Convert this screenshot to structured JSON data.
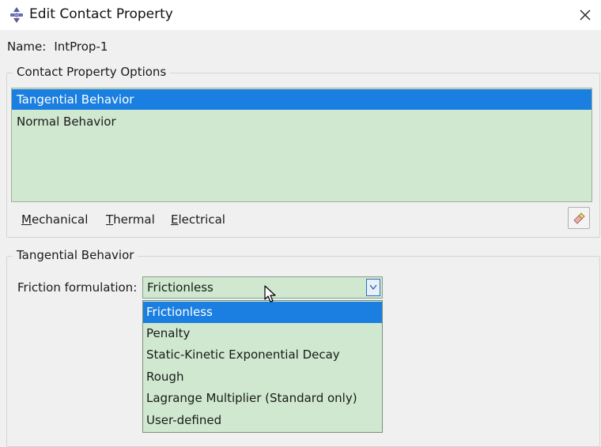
{
  "window": {
    "title": "Edit Contact Property"
  },
  "name_row": {
    "label": "Name:",
    "value": "IntProp-1"
  },
  "options_group": {
    "title": "Contact Property Options",
    "items": [
      {
        "label": "Tangential Behavior",
        "selected": true
      },
      {
        "label": "Normal Behavior",
        "selected": false
      }
    ],
    "menus": [
      {
        "mnemonic": "M",
        "rest": "echanical"
      },
      {
        "mnemonic": "T",
        "rest": "hermal"
      },
      {
        "mnemonic": "E",
        "rest": "lectrical"
      }
    ]
  },
  "tangential_group": {
    "title": "Tangential Behavior",
    "friction_label": "Friction formulation:",
    "friction_value": "Frictionless",
    "dropdown_options": [
      {
        "label": "Frictionless",
        "selected": true
      },
      {
        "label": "Penalty",
        "selected": false
      },
      {
        "label": "Static-Kinetic Exponential Decay",
        "selected": false
      },
      {
        "label": "Rough",
        "selected": false
      },
      {
        "label": "Lagrange Multiplier (Standard only)",
        "selected": false
      },
      {
        "label": "User-defined",
        "selected": false
      }
    ]
  },
  "icons": {
    "app": "abaqus-logo-icon",
    "close": "close-icon",
    "eraser": "eraser-icon",
    "combo_arrow": "chevron-down-icon",
    "cursor": "mouse-pointer-icon"
  },
  "colors": {
    "list_background": "#cfe8cf",
    "selection": "#1a7fe0",
    "dialog_background": "#f0f0f0"
  }
}
